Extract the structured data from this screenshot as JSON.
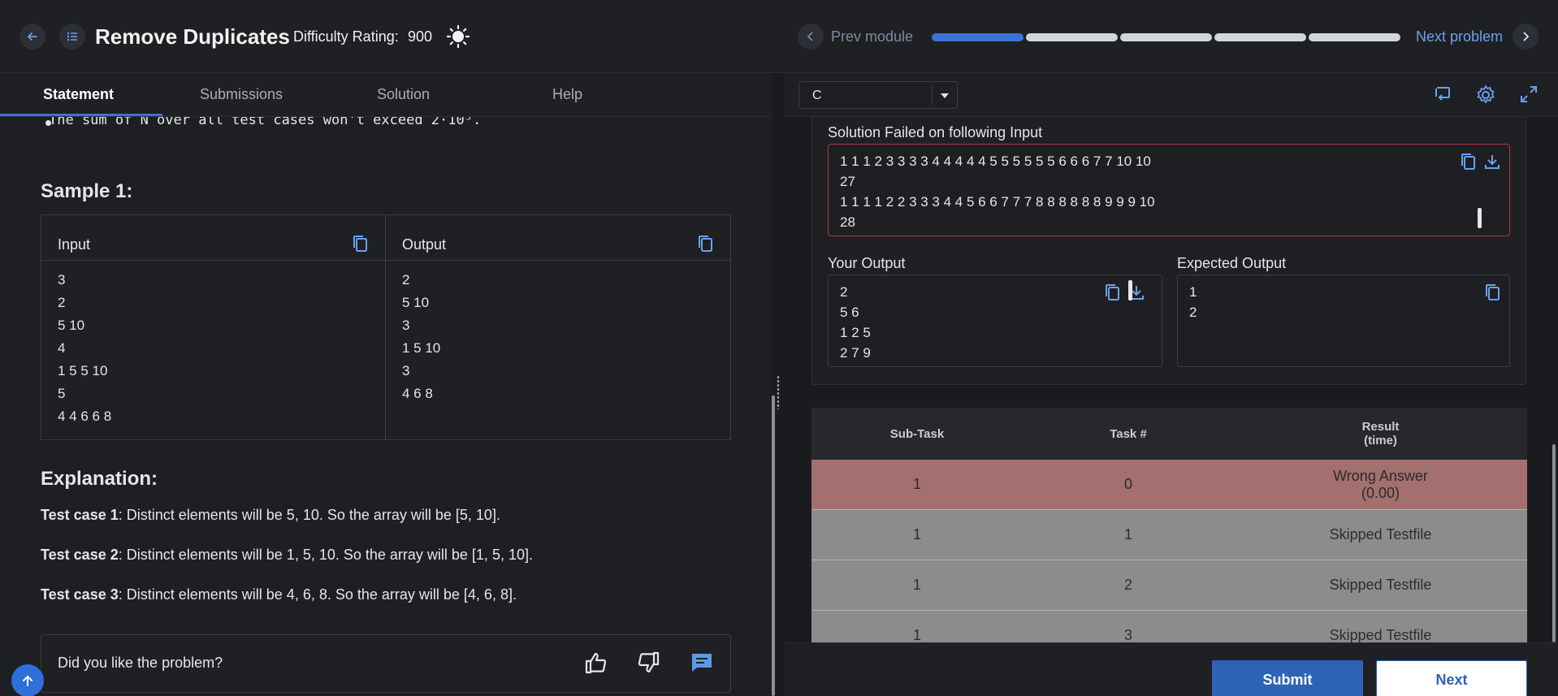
{
  "header": {
    "title": "Remove Duplicates",
    "difficulty_label": "Difficulty Rating:",
    "difficulty_value": "900",
    "prev_label": "Prev module",
    "next_label": "Next problem",
    "progress": {
      "segments": 5,
      "active": 1
    }
  },
  "tabs": [
    {
      "label": "Statement",
      "active": true
    },
    {
      "label": "Submissions"
    },
    {
      "label": "Solution"
    },
    {
      "label": "Help"
    }
  ],
  "statement": {
    "constraint_text": "The sum of N over all test cases won't exceed 2·10⁵.",
    "sample_title": "Sample 1:",
    "input_header": "Input",
    "output_header": "Output",
    "input_lines": [
      "3",
      "2",
      "5 10",
      "4",
      "1 5 5 10",
      "5",
      "4 4 6 6 8"
    ],
    "output_lines": [
      "2",
      "5 10",
      "3",
      "1 5 10",
      "3",
      "4 6 8"
    ],
    "explanation_title": "Explanation:",
    "explanations": [
      {
        "case": "Test case 1",
        "text": ": Distinct elements will be 5, 10. So the array will be [5, 10]."
      },
      {
        "case": "Test case 2",
        "text": ": Distinct elements will be 1, 5, 10. So the array will be [1, 5, 10]."
      },
      {
        "case": "Test case 3",
        "text": ": Distinct elements will be 4, 6, 8. So the array will be [4, 6, 8]."
      }
    ],
    "feedback_question": "Did you like the problem?"
  },
  "editor": {
    "language": "C"
  },
  "result": {
    "failed_label": "Solution Failed on following Input",
    "failed_input_lines": [
      "1 1 1 2 3 3 3 3 4 4 4 4 4 5 5 5 5 5 5 6 6 6 7 7 10 10",
      "27",
      "1 1 1 1 2 2 3 3 3 4 4 5 6 6 7 7 7 8 8 8 8 8 8 9 9 9 10",
      "28"
    ],
    "your_output_label": "Your Output",
    "your_output_lines": [
      "2",
      "5 6",
      "1 2 5",
      "2 7 9"
    ],
    "expected_output_label": "Expected Output",
    "expected_output_lines": [
      "1",
      "2"
    ]
  },
  "tasks": {
    "headers": {
      "subtask": "Sub-Task",
      "task": "Task #",
      "result_line1": "Result",
      "result_line2": "(time)"
    },
    "rows": [
      {
        "subtask": "1",
        "task": "0",
        "result": "Wrong Answer",
        "time": "(0.00)",
        "status": "fail"
      },
      {
        "subtask": "1",
        "task": "1",
        "result": "Skipped Testfile",
        "status": "skip"
      },
      {
        "subtask": "1",
        "task": "2",
        "result": "Skipped Testfile",
        "status": "skip"
      },
      {
        "subtask": "1",
        "task": "3",
        "result": "Skipped Testfile",
        "status": "skip"
      }
    ]
  },
  "actions": {
    "submit_label": "Submit",
    "next_label": "Next"
  },
  "colors": {
    "accent": "#3a73d4",
    "fail_row": "#a36f6f",
    "skip_row": "#8c8c8c",
    "failed_border": "#a63c3c"
  }
}
